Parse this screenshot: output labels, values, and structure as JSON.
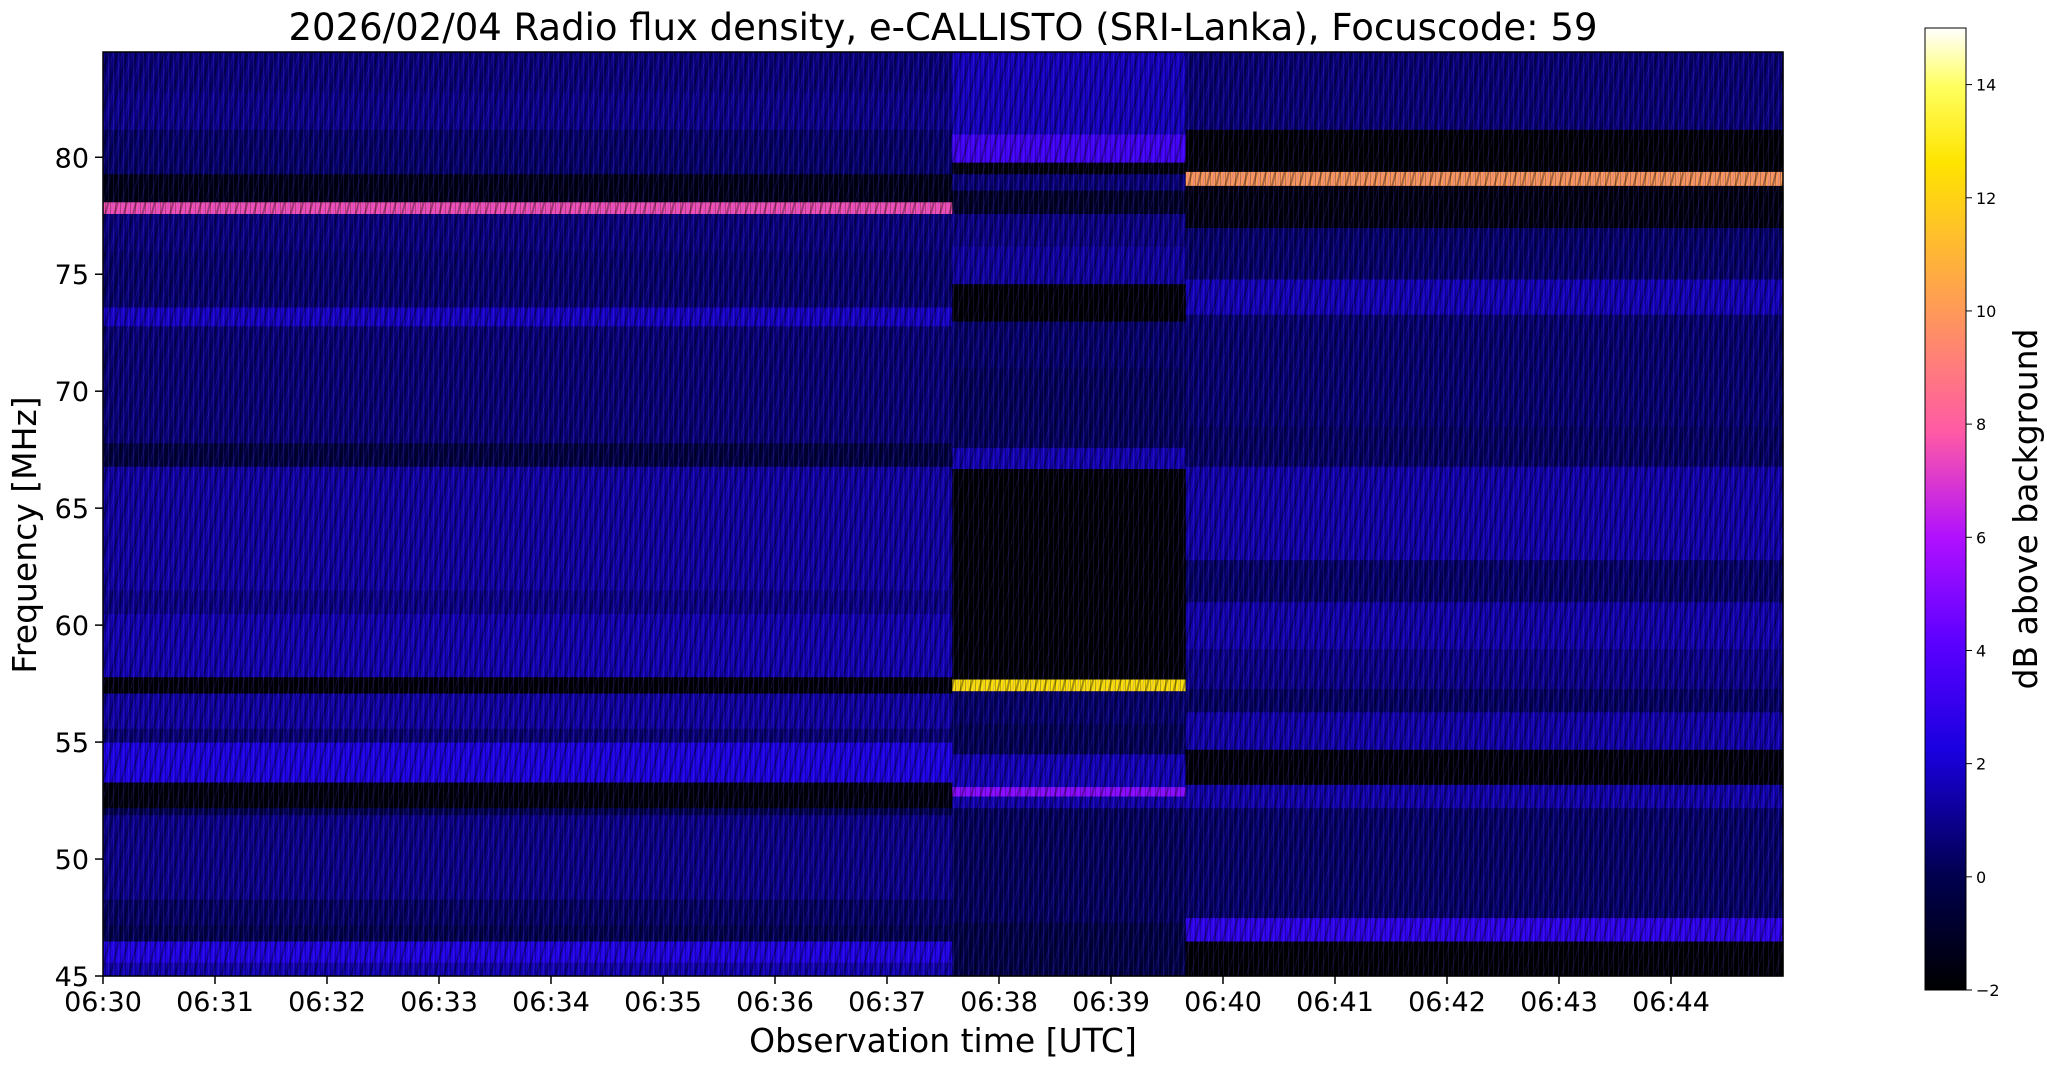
{
  "chart_data": {
    "type": "heatmap",
    "title": "2026/02/04  Radio flux density, e-CALLISTO (SRI-Lanka), Focuscode: 59",
    "xlabel": "Observation time [UTC]",
    "ylabel": "Frequency [MHz]",
    "colorbar_label": "dB above background",
    "xlim": [
      "06:30",
      "06:45"
    ],
    "ylim": [
      45,
      84.5
    ],
    "x_ticks": [
      "06:30",
      "06:31",
      "06:32",
      "06:33",
      "06:34",
      "06:35",
      "06:36",
      "06:37",
      "06:38",
      "06:39",
      "06:40",
      "06:41",
      "06:42",
      "06:43",
      "06:44"
    ],
    "y_ticks": [
      45,
      50,
      55,
      60,
      65,
      70,
      75,
      80
    ],
    "colorbar_range": [
      -2,
      15
    ],
    "colorbar_ticks": [
      -2,
      0,
      2,
      4,
      6,
      8,
      10,
      12,
      14
    ],
    "colormap": "gnuplot2",
    "segments": [
      {
        "start": "06:30",
        "end": "06:37:35",
        "bands": [
          {
            "f": [
              45,
              45.6
            ],
            "db": 1.5
          },
          {
            "f": [
              45.6,
              46.5
            ],
            "db": 2.4
          },
          {
            "f": [
              46.5,
              47.2
            ],
            "db": 0.0
          },
          {
            "f": [
              47.2,
              48.3
            ],
            "db": 0.3
          },
          {
            "f": [
              48.3,
              51.9
            ],
            "db": 0.9
          },
          {
            "f": [
              51.9,
              52.2
            ],
            "db": 0.0
          },
          {
            "f": [
              52.2,
              53.3
            ],
            "db": -1.8
          },
          {
            "f": [
              53.3,
              55.0
            ],
            "db": 2.3
          },
          {
            "f": [
              55.0,
              55.6
            ],
            "db": 0.6
          },
          {
            "f": [
              55.6,
              57.1
            ],
            "db": 1.3
          },
          {
            "f": [
              57.1,
              57.8
            ],
            "db": -1.9
          },
          {
            "f": [
              57.8,
              60.5
            ],
            "db": 1.5
          },
          {
            "f": [
              60.5,
              61.5
            ],
            "db": 0.9
          },
          {
            "f": [
              61.5,
              66.8
            ],
            "db": 1.3
          },
          {
            "f": [
              66.8,
              67.8
            ],
            "db": -0.4
          },
          {
            "f": [
              67.8,
              72.8
            ],
            "db": 0.6
          },
          {
            "f": [
              72.8,
              73.6
            ],
            "db": 1.8
          },
          {
            "f": [
              73.6,
              76.0
            ],
            "db": 0.5
          },
          {
            "f": [
              76.0,
              77.6
            ],
            "db": 0.7
          },
          {
            "f": [
              77.6,
              78.1
            ],
            "db": 7.6
          },
          {
            "f": [
              78.1,
              79.3
            ],
            "db": -1.5
          },
          {
            "f": [
              79.3,
              81.2
            ],
            "db": 0.4
          },
          {
            "f": [
              81.2,
              82.8
            ],
            "db": 0.9
          },
          {
            "f": [
              82.8,
              84.5
            ],
            "db": 0.7
          }
        ]
      },
      {
        "start": "06:37:35",
        "end": "06:39:40",
        "bands": [
          {
            "f": [
              45,
              47.3
            ],
            "db": -0.3
          },
          {
            "f": [
              47.3,
              52.2
            ],
            "db": 0.2
          },
          {
            "f": [
              52.2,
              52.7
            ],
            "db": 1.4
          },
          {
            "f": [
              52.7,
              53.1
            ],
            "db": 5.2
          },
          {
            "f": [
              53.1,
              54.5
            ],
            "db": 1.6
          },
          {
            "f": [
              54.5,
              55.8
            ],
            "db": 0.1
          },
          {
            "f": [
              55.8,
              57.2
            ],
            "db": 0.4
          },
          {
            "f": [
              57.2,
              57.7
            ],
            "db": 12.5
          },
          {
            "f": [
              57.7,
              66.7
            ],
            "db": -2.0
          },
          {
            "f": [
              66.7,
              67.6
            ],
            "db": 1.5
          },
          {
            "f": [
              67.6,
              71.0
            ],
            "db": 0.2
          },
          {
            "f": [
              71.0,
              73.0
            ],
            "db": 0.4
          },
          {
            "f": [
              73.0,
              74.6
            ],
            "db": -2.0
          },
          {
            "f": [
              74.6,
              76.2
            ],
            "db": 1.2
          },
          {
            "f": [
              76.2,
              77.6
            ],
            "db": 0.8
          },
          {
            "f": [
              77.6,
              78.6
            ],
            "db": -1.0
          },
          {
            "f": [
              78.6,
              79.3
            ],
            "db": 0.6
          },
          {
            "f": [
              79.3,
              79.8
            ],
            "db": -1.8
          },
          {
            "f": [
              79.8,
              81.0
            ],
            "db": 3.4
          },
          {
            "f": [
              81.0,
              84.5
            ],
            "db": 1.7
          }
        ]
      },
      {
        "start": "06:39:40",
        "end": "06:45",
        "bands": [
          {
            "f": [
              45,
              46.5
            ],
            "db": -2.0
          },
          {
            "f": [
              46.5,
              47.5
            ],
            "db": 2.8
          },
          {
            "f": [
              47.5,
              52.2
            ],
            "db": 0.4
          },
          {
            "f": [
              52.2,
              53.2
            ],
            "db": 1.4
          },
          {
            "f": [
              53.2,
              54.7
            ],
            "db": -1.9
          },
          {
            "f": [
              54.7,
              56.3
            ],
            "db": 1.4
          },
          {
            "f": [
              56.3,
              57.3
            ],
            "db": 0.3
          },
          {
            "f": [
              57.3,
              59.0
            ],
            "db": 0.9
          },
          {
            "f": [
              59.0,
              61.0
            ],
            "db": 1.4
          },
          {
            "f": [
              61.0,
              62.8
            ],
            "db": 0.4
          },
          {
            "f": [
              62.8,
              66.8
            ],
            "db": 1.4
          },
          {
            "f": [
              66.8,
              68.5
            ],
            "db": 0.3
          },
          {
            "f": [
              68.5,
              73.3
            ],
            "db": 0.5
          },
          {
            "f": [
              73.3,
              74.8
            ],
            "db": 1.6
          },
          {
            "f": [
              74.8,
              77.0
            ],
            "db": 0.4
          },
          {
            "f": [
              77.0,
              78.8
            ],
            "db": -1.7
          },
          {
            "f": [
              78.8,
              79.4
            ],
            "db": 10.0
          },
          {
            "f": [
              79.4,
              81.2
            ],
            "db": -2.0
          },
          {
            "f": [
              81.2,
              84.5
            ],
            "db": 0.6
          }
        ]
      }
    ]
  }
}
